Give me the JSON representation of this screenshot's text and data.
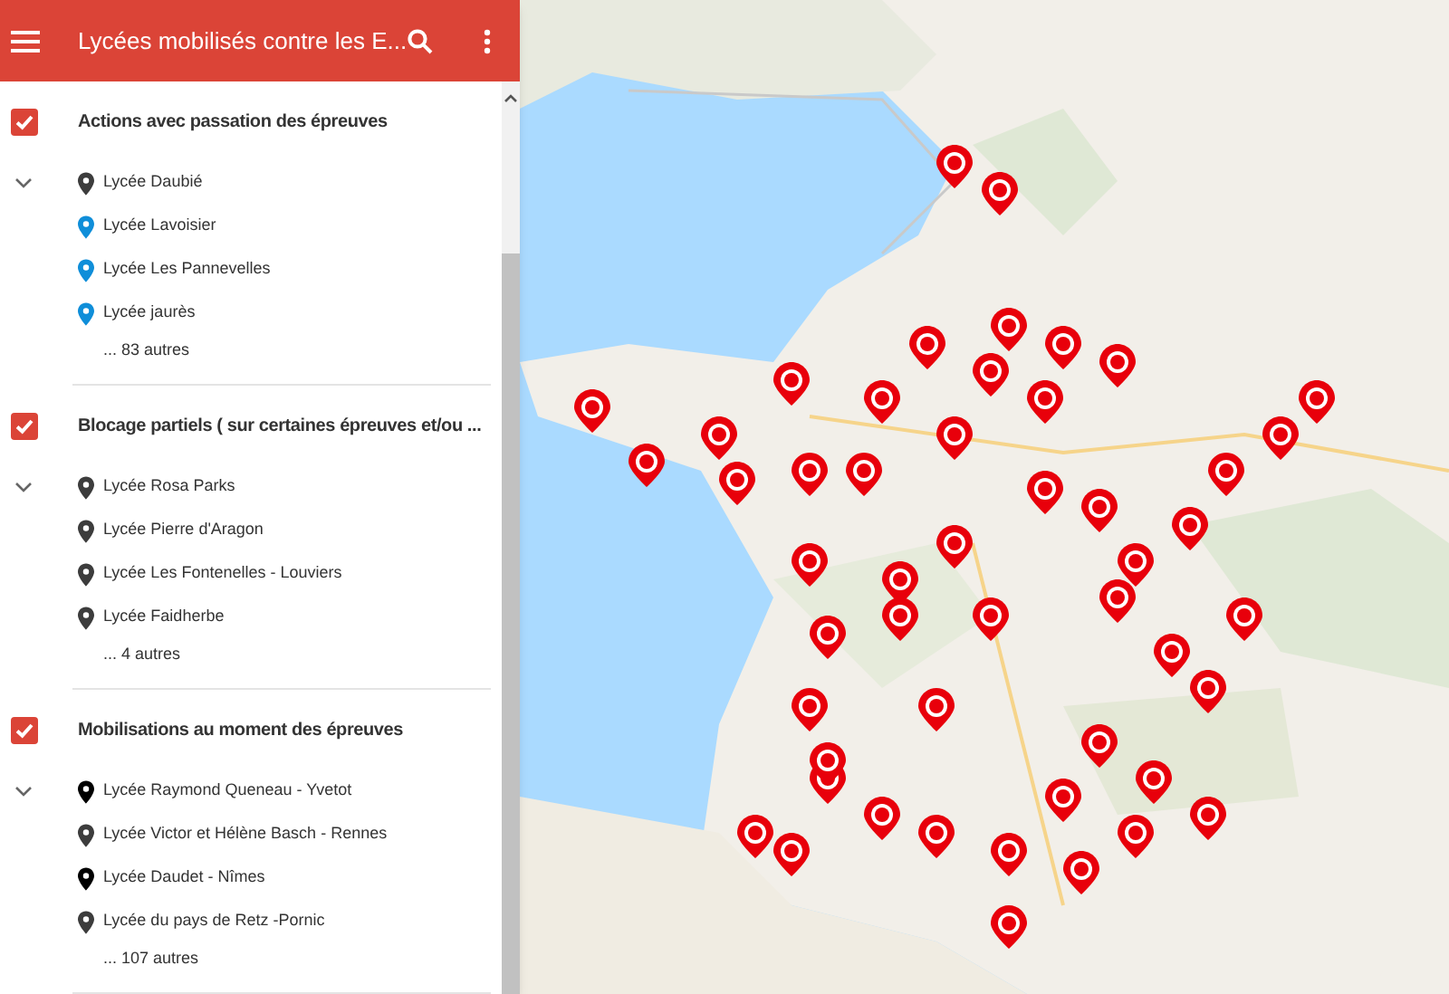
{
  "header": {
    "title": "Lycées mobilisés contre les E..."
  },
  "layers": [
    {
      "title": "Actions avec passation des épreuves",
      "checked": true,
      "expanded": true,
      "items": [
        {
          "label": "Lycée Daubié",
          "color": "#3c3c3c"
        },
        {
          "label": "Lycée Lavoisier",
          "color": "#0f8ed9"
        },
        {
          "label": "Lycée Les Pannevelles",
          "color": "#0f8ed9"
        },
        {
          "label": "Lycée jaurès",
          "color": "#0f8ed9"
        }
      ],
      "more": "... 83 autres"
    },
    {
      "title": "Blocage partiels ( sur certaines épreuves et/ou ...",
      "checked": true,
      "expanded": true,
      "items": [
        {
          "label": "Lycée Rosa Parks",
          "color": "#3c3c3c"
        },
        {
          "label": "Lycée Pierre d'Aragon",
          "color": "#3c3c3c"
        },
        {
          "label": "Lycée Les Fontenelles - Louviers",
          "color": "#3c3c3c"
        },
        {
          "label": "Lycée Faidherbe",
          "color": "#3c3c3c"
        }
      ],
      "more": "... 4 autres"
    },
    {
      "title": "Mobilisations au moment des épreuves",
      "checked": true,
      "expanded": true,
      "items": [
        {
          "label": "Lycée Raymond Queneau - Yvetot",
          "color": "#000000"
        },
        {
          "label": "Lycée Victor et Hélène Basch - Rennes",
          "color": "#3c3c3c"
        },
        {
          "label": "Lycée Daudet - Nîmes",
          "color": "#000000"
        },
        {
          "label": "Lycée du pays de Retz -Pornic",
          "color": "#3c3c3c"
        }
      ],
      "more": "... 107 autres"
    }
  ]
}
